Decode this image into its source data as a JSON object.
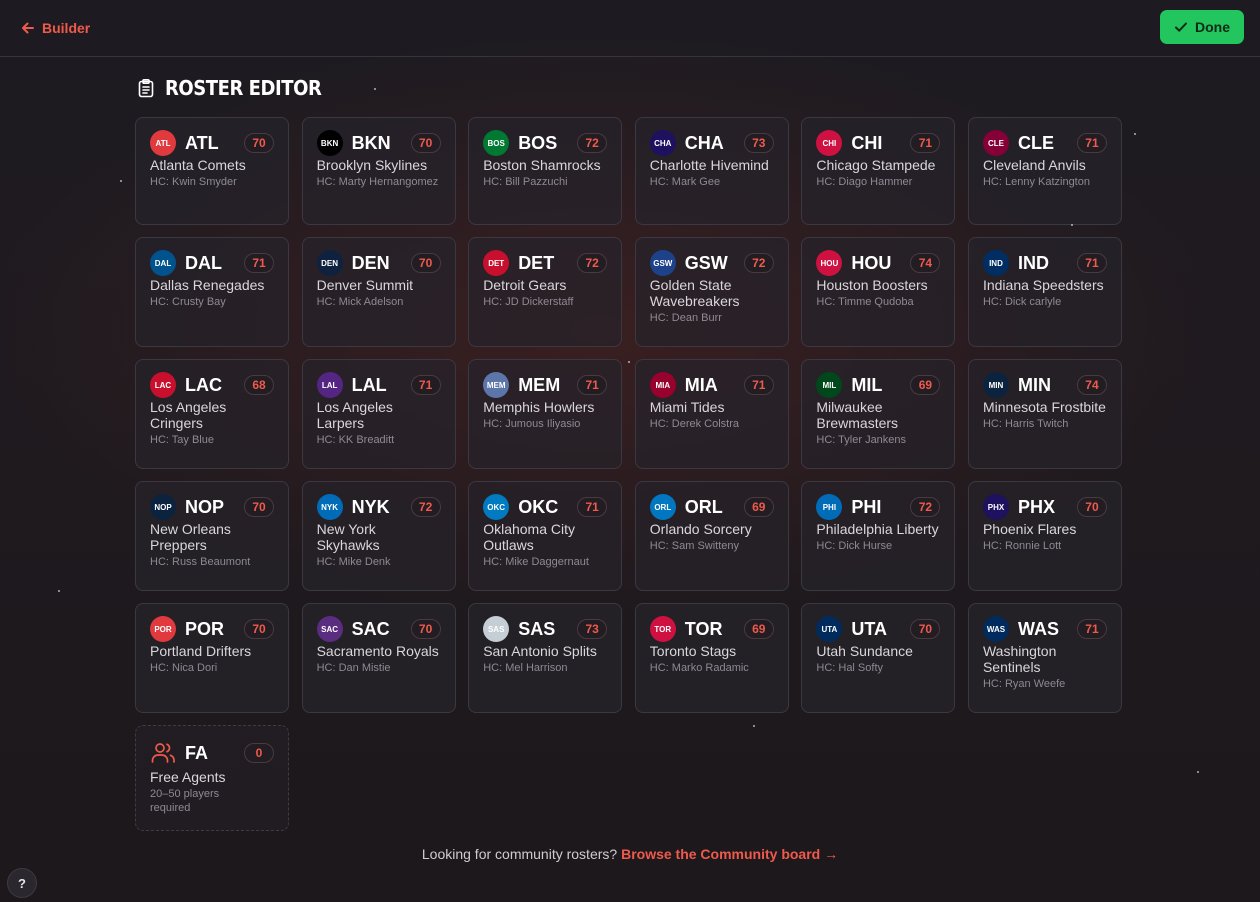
{
  "header": {
    "back_label": "Builder",
    "done_label": "Done"
  },
  "page": {
    "title": "ROSTER EDITOR"
  },
  "teams": [
    {
      "abbr": "ATL",
      "name": "Atlanta Comets",
      "coach": "HC: Kwin Smyder",
      "ovr": "70",
      "color": "#e03a3e"
    },
    {
      "abbr": "BKN",
      "name": "Brooklyn Skylines",
      "coach": "HC: Marty Hernangomez",
      "ovr": "70",
      "color": "#000000"
    },
    {
      "abbr": "BOS",
      "name": "Boston Shamrocks",
      "coach": "HC: Bill Pazzuchi",
      "ovr": "72",
      "color": "#007a33"
    },
    {
      "abbr": "CHA",
      "name": "Charlotte Hivemind",
      "coach": "HC: Mark Gee",
      "ovr": "73",
      "color": "#1d1160"
    },
    {
      "abbr": "CHI",
      "name": "Chicago Stampede",
      "coach": "HC: Diago Hammer",
      "ovr": "71",
      "color": "#ce1141"
    },
    {
      "abbr": "CLE",
      "name": "Cleveland Anvils",
      "coach": "HC: Lenny Katzington",
      "ovr": "71",
      "color": "#860038"
    },
    {
      "abbr": "DAL",
      "name": "Dallas Renegades",
      "coach": "HC: Crusty Bay",
      "ovr": "71",
      "color": "#00538c"
    },
    {
      "abbr": "DEN",
      "name": "Denver Summit",
      "coach": "HC: Mick Adelson",
      "ovr": "70",
      "color": "#0e2240"
    },
    {
      "abbr": "DET",
      "name": "Detroit Gears",
      "coach": "HC: JD Dickerstaff",
      "ovr": "72",
      "color": "#c8102e"
    },
    {
      "abbr": "GSW",
      "name": "Golden State Wavebreakers",
      "coach": "HC: Dean Burr",
      "ovr": "72",
      "color": "#1d428a"
    },
    {
      "abbr": "HOU",
      "name": "Houston Boosters",
      "coach": "HC: Timme Qudoba",
      "ovr": "74",
      "color": "#ce1141"
    },
    {
      "abbr": "IND",
      "name": "Indiana Speedsters",
      "coach": "HC: Dick carlyle",
      "ovr": "71",
      "color": "#002d62"
    },
    {
      "abbr": "LAC",
      "name": "Los Angeles Cringers",
      "coach": "HC: Tay Blue",
      "ovr": "68",
      "color": "#c8102e"
    },
    {
      "abbr": "LAL",
      "name": "Los Angeles Larpers",
      "coach": "HC: KK Breaditt",
      "ovr": "71",
      "color": "#552583"
    },
    {
      "abbr": "MEM",
      "name": "Memphis Howlers",
      "coach": "HC: Jumous Iliyasio",
      "ovr": "71",
      "color": "#5d76a9"
    },
    {
      "abbr": "MIA",
      "name": "Miami Tides",
      "coach": "HC: Derek Colstra",
      "ovr": "71",
      "color": "#98002e"
    },
    {
      "abbr": "MIL",
      "name": "Milwaukee Brewmasters",
      "coach": "HC: Tyler Jankens",
      "ovr": "69",
      "color": "#00471b"
    },
    {
      "abbr": "MIN",
      "name": "Minnesota Frostbite",
      "coach": "HC: Harris Twitch",
      "ovr": "74",
      "color": "#0c2340"
    },
    {
      "abbr": "NOP",
      "name": "New Orleans Preppers",
      "coach": "HC: Russ Beaumont",
      "ovr": "70",
      "color": "#0c2340"
    },
    {
      "abbr": "NYK",
      "name": "New York Skyhawks",
      "coach": "HC: Mike Denk",
      "ovr": "72",
      "color": "#006bb6"
    },
    {
      "abbr": "OKC",
      "name": "Oklahoma City Outlaws",
      "coach": "HC: Mike Daggernaut",
      "ovr": "71",
      "color": "#007ac1"
    },
    {
      "abbr": "ORL",
      "name": "Orlando Sorcery",
      "coach": "HC: Sam Switteny",
      "ovr": "69",
      "color": "#0077c0"
    },
    {
      "abbr": "PHI",
      "name": "Philadelphia Liberty",
      "coach": "HC: Dick Hurse",
      "ovr": "72",
      "color": "#006bb6"
    },
    {
      "abbr": "PHX",
      "name": "Phoenix Flares",
      "coach": "HC: Ronnie Lott",
      "ovr": "70",
      "color": "#1d1160"
    },
    {
      "abbr": "POR",
      "name": "Portland Drifters",
      "coach": "HC: Nica Dori",
      "ovr": "70",
      "color": "#e03a3e"
    },
    {
      "abbr": "SAC",
      "name": "Sacramento Royals",
      "coach": "HC: Dan Mistie",
      "ovr": "70",
      "color": "#5a2d81"
    },
    {
      "abbr": "SAS",
      "name": "San Antonio Splits",
      "coach": "HC: Mel Harrison",
      "ovr": "73",
      "color": "#c4ced4"
    },
    {
      "abbr": "TOR",
      "name": "Toronto Stags",
      "coach": "HC: Marko Radamic",
      "ovr": "69",
      "color": "#ce1141"
    },
    {
      "abbr": "UTA",
      "name": "Utah Sundance",
      "coach": "HC: Hal Softy",
      "ovr": "70",
      "color": "#002b5c"
    },
    {
      "abbr": "WAS",
      "name": "Washington Sentinels",
      "coach": "HC: Ryan Weefe",
      "ovr": "71",
      "color": "#002b5c"
    }
  ],
  "free_agents": {
    "abbr": "FA",
    "name": "Free Agents",
    "note": "20–50 players required",
    "count": "0"
  },
  "footer": {
    "prompt": "Looking for community rosters?",
    "link": "Browse the Community board →"
  },
  "help": {
    "label": "?"
  },
  "colors": {
    "accent": "#ef5a4c",
    "done": "#22c55e"
  }
}
